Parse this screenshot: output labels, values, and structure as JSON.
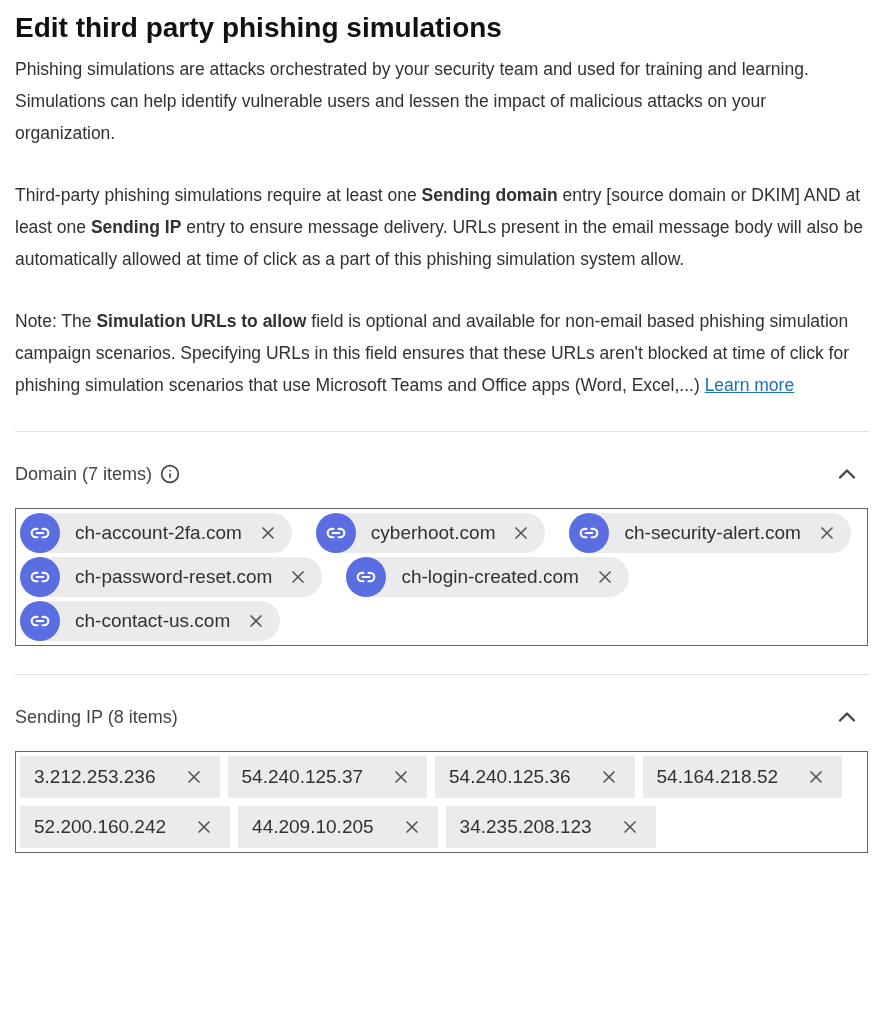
{
  "title": "Edit third party phishing simulations",
  "paragraphs": [
    {
      "text": "Phishing simulations are attacks orchestrated by your security team and used for training and learning. Simulations can help identify vulnerable users and lessen the impact of malicious attacks on your organization."
    },
    {
      "text": "Third-party phishing simulations require at least one **Sending domain** entry [source domain or DKIM] AND at least one **Sending IP** entry to ensure message delivery. URLs present in the email message body will also be automatically allowed at time of click as a part of this phishing simulation system allow."
    },
    {
      "text": "Note: The **Simulation URLs to allow** field is optional and available for non-email based phishing simulation campaign scenarios. Specifying URLs in this field ensures that these URLs aren't blocked at time of click for phishing simulation scenarios that use Microsoft Teams and Office apps (Word, Excel,...)",
      "link": "Learn more"
    }
  ],
  "sections": [
    {
      "kind": "domain",
      "label": "Domain (7 items)",
      "info": true,
      "expanded": true,
      "items": [
        "ch-account-2fa.com",
        "cyberhoot.com",
        "ch-security-alert.com",
        "ch-password-reset.com",
        "ch-login-created.com",
        "ch-contact-us.com"
      ]
    },
    {
      "kind": "ip",
      "label": "Sending IP (8 items)",
      "info": false,
      "expanded": true,
      "items": [
        "3.212.253.236",
        "54.240.125.37",
        "54.240.125.36",
        "54.164.218.52",
        "52.200.160.242",
        "44.209.10.205",
        "34.235.208.123"
      ]
    }
  ]
}
